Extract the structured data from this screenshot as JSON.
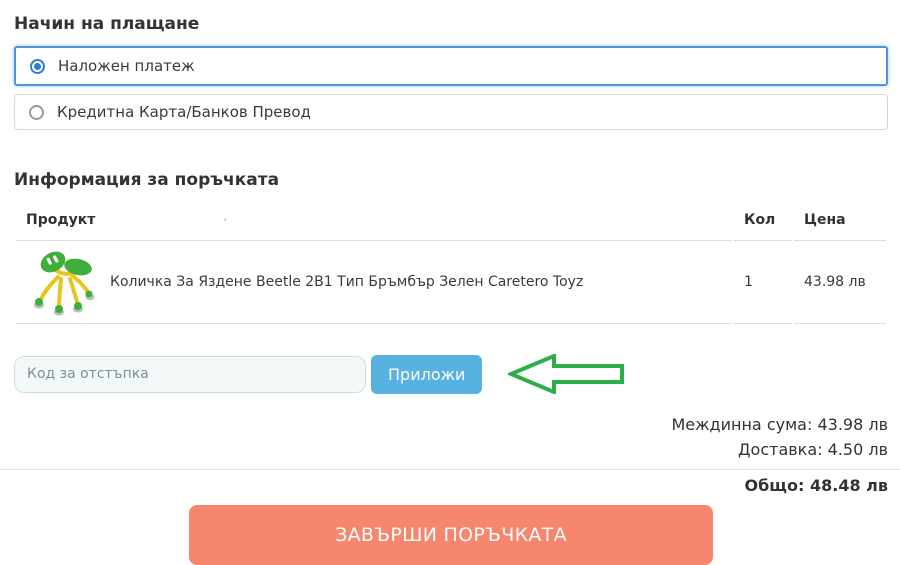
{
  "payment": {
    "title": "Начин на плащане",
    "options": [
      {
        "label": "Наложен платеж",
        "selected": true
      },
      {
        "label": "Кредитна Карта/Банков Превод",
        "selected": false
      }
    ]
  },
  "order": {
    "title": "Информация за поръчката",
    "headers": {
      "product": "Продукт",
      "qty": "Кол",
      "price": "Цена"
    },
    "header_dot": "·",
    "rows": [
      {
        "product": "Количка За Яздене Beetle 2B1 Тип Бръмбър Зелен Caretero Toyz",
        "qty": "1",
        "price": "43.98 лв"
      }
    ]
  },
  "discount": {
    "placeholder": "Код за отстъпка",
    "value": "",
    "apply_label": "Приложи"
  },
  "totals": {
    "subtotal_label": "Междинна сума:",
    "subtotal_value": "43.98 лв",
    "shipping_label": "Доставка:",
    "shipping_value": "4.50 лв",
    "total_label": "Общо:",
    "total_value": "48.48 лв"
  },
  "submit_label": "ЗАВЪРШИ ПОРЪЧКАТА",
  "icons": {
    "product_image": "green-beetle-ride-on-toy",
    "arrow": "left-pointing-outline-arrow",
    "radio_checked": "filled-blue-radio",
    "radio_unchecked": "empty-gray-radio"
  },
  "colors": {
    "selected_border": "#5094dd",
    "radio_blue": "#2e7cd6",
    "apply_button_bg": "#57b2e2",
    "submit_button_bg": "#f6876e",
    "arrow_green": "#2baf4a"
  }
}
